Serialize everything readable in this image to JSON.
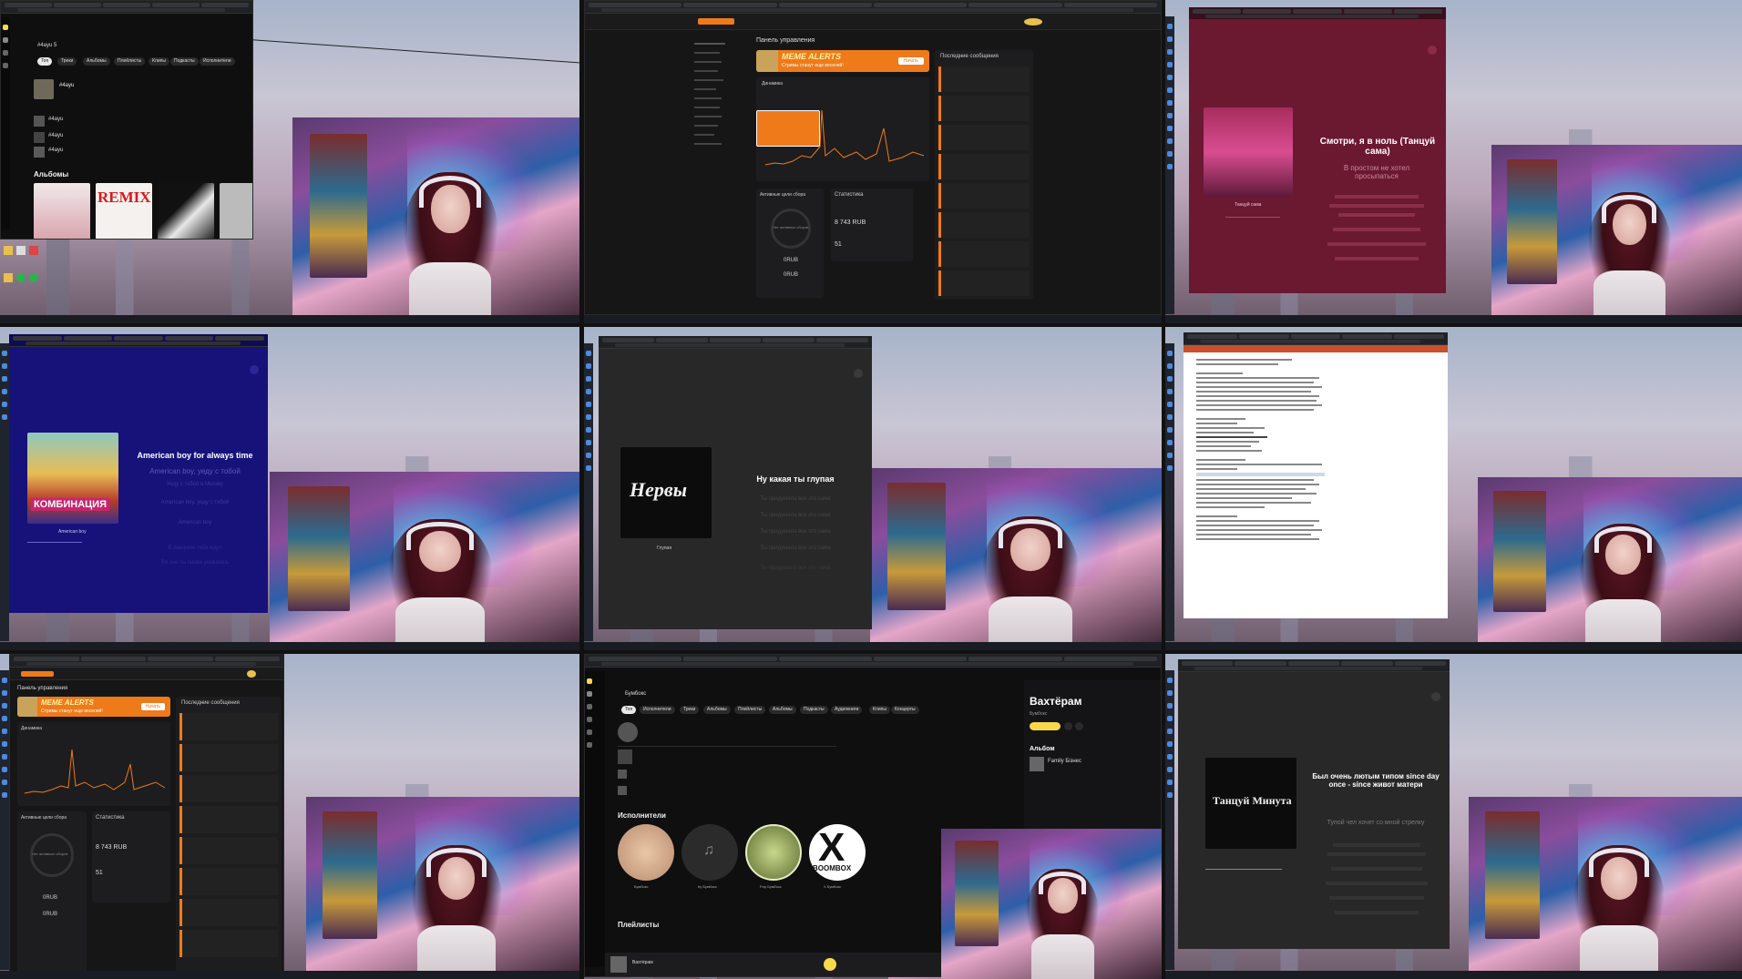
{
  "tiles": {
    "t1": {
      "search": "#4ayu 5",
      "filters": [
        "Топ",
        "Треки",
        "Альбомы",
        "Плейлисты",
        "Клипы",
        "Подкасты",
        "Исполнители"
      ],
      "top_artist": "#4ayu",
      "tracks": [
        "#4ayu",
        "#4ayu",
        "#4ayu"
      ],
      "section": "Альбомы",
      "remix_label": "REMIX"
    },
    "t2": {
      "header": "Панель управления",
      "banner_brand": "MEME ALERTS",
      "banner_text": "Стримы станут еще веселей!",
      "banner_button": "Начать",
      "stats_title": "Динамика",
      "messages_title": "Последние сообщения",
      "goals_title": "Активные цели сбора",
      "goals_empty": "Нет активных сборов",
      "stats_box_title": "Статистика",
      "amount": "8 743 RUB",
      "count": "51",
      "zero1": "0RUB",
      "zero2": "0RUB"
    },
    "t3": {
      "title": "Смотри, я в ноль (Танцуй сама)",
      "lyric_line": "В простом не хотел просыпаться",
      "artist_under": "Танцуй сама"
    },
    "t4": {
      "title": "American boy for always time",
      "lines": [
        "American boy, уеду с тобой",
        "Уеду с тобой в Москву",
        "American boy, уеду с тобой",
        "American boy",
        "В Америке тебя ждут",
        "Во сне ты снова уезжаешь"
      ],
      "poster_text": "КОМБИНАЦИЯ",
      "track": "American boy"
    },
    "t5": {
      "cover_text": "Нервы",
      "title": "Ну какая ты глупая",
      "lines": [
        "Ты придумала все это сама",
        "Ты придумала все это сама",
        "Ты придумала все это сама",
        "Ты придумала все это сама",
        "Ты придумала все это сама"
      ],
      "track": "Глупая"
    },
    "t6": {
      "doc_lines": 40
    },
    "t7": {
      "header": "Панель управления",
      "banner_brand": "MEME ALERTS",
      "banner_text": "Стримы станут еще веселей!",
      "banner_button": "Начать",
      "stats_title": "Динамика",
      "messages_title": "Последние сообщения",
      "goals_title": "Активные цели сбора",
      "goals_empty": "Нет активных сборов",
      "stats_box_title": "Статистика",
      "amount": "8 743 RUB",
      "count": "51",
      "zero1": "0RUB",
      "zero2": "0RUB"
    },
    "t8": {
      "search": "Бумбокс",
      "filters": [
        "Топ",
        "Исполнители",
        "Треки",
        "Альбомы",
        "Плейлисты",
        "Альбомы",
        "Подкасты",
        "Аудиокниги",
        "Клипы",
        "Концерты"
      ],
      "sidebar_title": "Вахтёрам",
      "sidebar_artist": "Бумбокс",
      "album_label": "Альбом",
      "album_name": "Family Бізнес",
      "artists_title": "Исполнители",
      "playlists_title": "Плейлисты",
      "artist_names": [
        "Бумбокс",
        "by Бумбокс",
        "Pop Бумбокс",
        "X Бумбокс"
      ],
      "now_playing": "Вахтёрам",
      "boombox_text": "BOOMBOX"
    },
    "t9": {
      "cover_text": "Танцуй Минута",
      "title": "Был очень лютым типом since day once - since живот матери",
      "line1": "Тупой чел хочет со мной стрелку"
    }
  },
  "colors": {
    "accent_orange": "#ef7a1a",
    "ym_yellow": "#f8d94a",
    "lyrics_maroon": "#6b1831",
    "lyrics_navy": "#16127a"
  }
}
